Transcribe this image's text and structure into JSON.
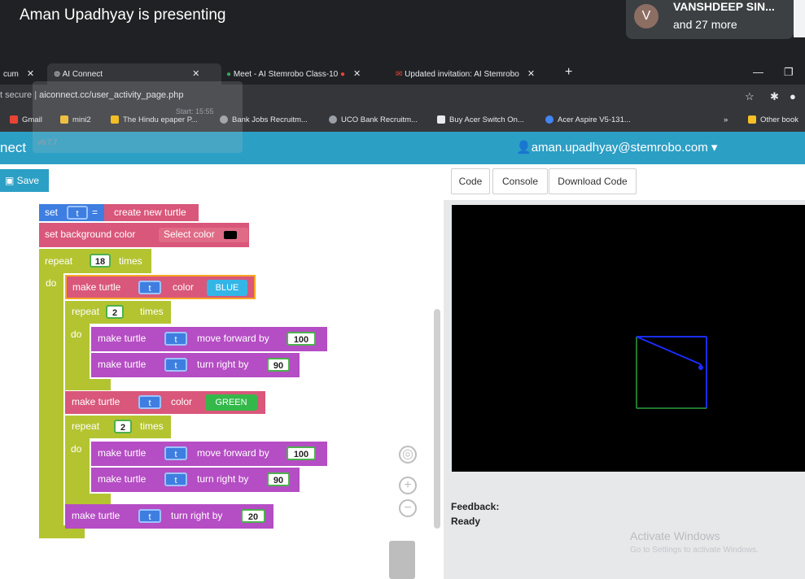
{
  "meet": {
    "presenting_text": "Aman Upadhyay is presenting",
    "avatar_letter": "V",
    "participant_name": "VANSHDEEP SIN...",
    "participant_more": "and 27 more"
  },
  "browser": {
    "tabs": [
      {
        "label": "cum",
        "active": false
      },
      {
        "label": "AI Connect",
        "active": true
      },
      {
        "label": "Meet - AI Stemrobo Class-10",
        "active": false
      },
      {
        "label": "Updated invitation: AI Stemrobo",
        "active": false
      }
    ],
    "url_prefix": "t secure",
    "url": "aiconnect.cc/user_activity_page.php",
    "bookmarks": [
      "Gmail",
      "mini2",
      "The Hindu epaper P...",
      "Bank Jobs Recruitm...",
      "UCO Bank Recruitm...",
      "Buy Acer Switch On...",
      "Acer Aspire V5-131...",
      "Other book"
    ],
    "overlay_start": "Start: 15:55",
    "overlay_version": "v0.7.7"
  },
  "app": {
    "name": "nect",
    "user_email": "aman.upadhyay@stemrobo.com",
    "save_label": "Save",
    "right_buttons": [
      "Code",
      "Console",
      "Download Code"
    ],
    "feedback_label": "Feedback:",
    "feedback_value": "Ready",
    "activate_title": "Activate Windows",
    "activate_sub": "Go to Settings to activate Windows."
  },
  "blocks": {
    "set_label": "set",
    "var": "t",
    "eq": "=",
    "create_turtle": "create new turtle",
    "set_bg": "set background color",
    "select_color": "Select color",
    "repeat": "repeat",
    "times": "times",
    "do": "do",
    "outer_repeat": "18",
    "make_turtle": "make turtle",
    "color": "color",
    "blue": "BLUE",
    "green": "GREEN",
    "inner_repeat": "2",
    "move_forward": "move forward by",
    "turn_right": "turn right by",
    "forward_val": "100",
    "turn_val": "90",
    "final_turn": "20"
  },
  "colors": {
    "accent": "#2c9fc5",
    "block_pink": "#d9577a",
    "block_lime": "#b4c431",
    "block_purple": "#b54dc4"
  }
}
